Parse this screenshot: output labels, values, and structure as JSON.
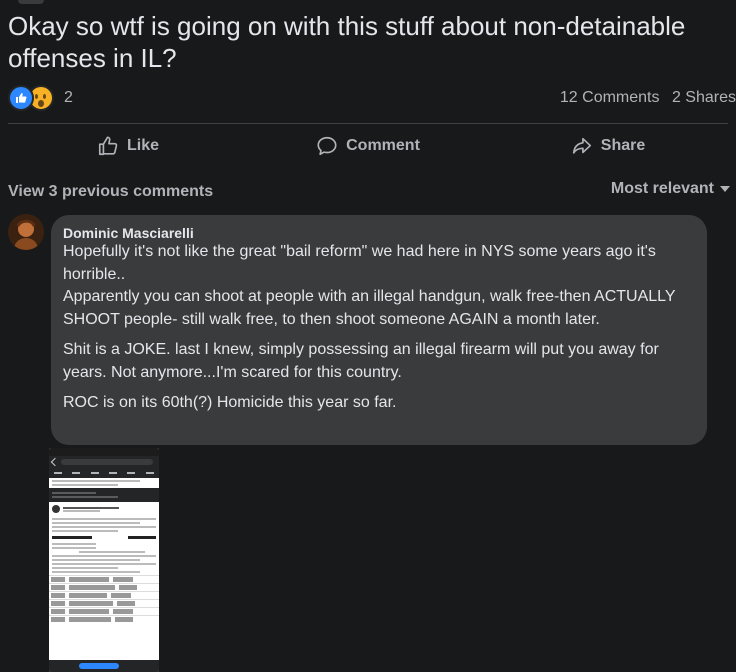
{
  "post": {
    "title": "Okay so wtf is going on with this stuff about non-detainable offenses in IL?",
    "reactions": {
      "icons": [
        "like-icon",
        "wow-icon"
      ],
      "count": "2"
    },
    "comments_count": "12 Comments",
    "shares_count": "2 Shares"
  },
  "actions": {
    "like": "Like",
    "comment": "Comment",
    "share": "Share"
  },
  "comments_section": {
    "view_previous": "View 3 previous comments",
    "sort": "Most relevant"
  },
  "comment": {
    "author": "Dominic Masciarelli",
    "paragraphs": [
      "Hopefully it's not like the great \"bail reform\" we had here in NYS some years ago it's horrible..\nApparently you can shoot at people with an illegal handgun, walk free-then ACTUALLY SHOOT people- still walk free, to then shoot someone AGAIN a month later.",
      "Shit is a JOKE. last I knew, simply possessing an illegal firearm will put you away for years. Not anymore...I'm scared for this country.",
      "ROC is on its 60th(?) Homicide this year so far."
    ],
    "attachment": "screenshot-image"
  },
  "colors": {
    "background": "#18191a",
    "bubble": "#3a3b3c",
    "text_primary": "#e4e6eb",
    "text_secondary": "#b0b3b8",
    "like_blue": "#2d88ff",
    "wow_yellow": "#f7b125"
  }
}
